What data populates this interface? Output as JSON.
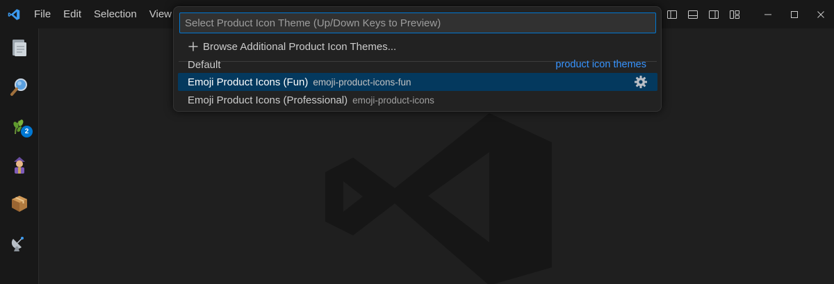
{
  "menu": [
    "File",
    "Edit",
    "Selection",
    "View"
  ],
  "icons": {
    "app": "vscode-logo-icon",
    "activity": [
      "explorer-icon",
      "search-icon",
      "source-control-icon",
      "run-debug-icon",
      "extensions-icon",
      "remote-explorer-icon"
    ],
    "layout_tools": [
      "toggle-primary-sidebar-icon",
      "toggle-panel-icon",
      "toggle-secondary-sidebar-icon",
      "customize-layout-icon"
    ],
    "window": [
      "minimize-icon",
      "maximize-icon",
      "close-icon"
    ]
  },
  "activity_badges": {
    "source_control": "2"
  },
  "quick_pick": {
    "placeholder": "Select Product Icon Theme (Up/Down Keys to Preview)",
    "browse_label": "Browse Additional Product Icon Themes...",
    "items": [
      {
        "label": "Default",
        "description": "",
        "link": "product icon themes",
        "selected": false
      },
      {
        "label": "Emoji Product Icons (Fun)",
        "description": "emoji-product-icons-fun",
        "selected": true
      },
      {
        "label": "Emoji Product Icons (Professional)",
        "description": "emoji-product-icons",
        "selected": false
      }
    ]
  },
  "colors": {
    "accent": "#0078d4",
    "selection": "#04395e",
    "link": "#3794ff",
    "background": "#1f1f1f"
  }
}
